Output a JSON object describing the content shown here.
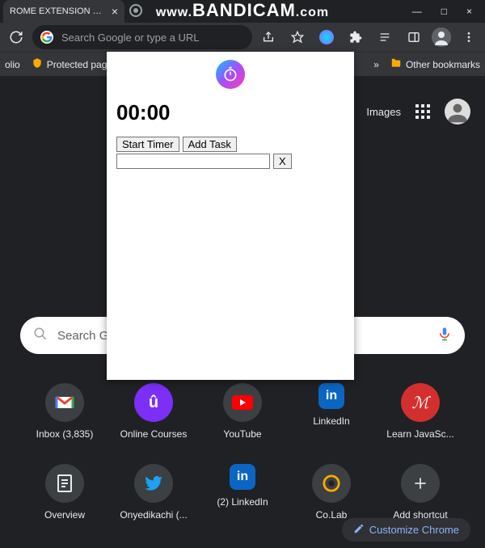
{
  "watermark": "WWW.BANDICAM.COM",
  "tabs": {
    "left_partial": "ROME EXTENSION FOR"
  },
  "window": {
    "minimize": "—",
    "maximize": "□",
    "close": "×"
  },
  "omnibox": {
    "placeholder": "Search Google or type a URL"
  },
  "bookmarks": {
    "item0": "olio",
    "item1": "Protected pag",
    "other": "Other bookmarks",
    "chevron": "»"
  },
  "ntp": {
    "images_link": "Images",
    "search_placeholder": "Search Goo",
    "customize": "Customize Chrome"
  },
  "shortcuts": [
    {
      "label": "Inbox (3,835)",
      "letter": "M",
      "bg": "#3c4043"
    },
    {
      "label": "Online Courses",
      "letter": "Û",
      "bg": "#3c4043"
    },
    {
      "label": "YouTube",
      "letter": "▶",
      "bg": "#3c4043"
    },
    {
      "label": "LinkedIn",
      "letter": "in",
      "bg": "#3c4043"
    },
    {
      "label": "Learn JavaSc...",
      "letter": "ℳ",
      "bg": "#3c4043"
    },
    {
      "label": "Overview",
      "letter": "🗎",
      "bg": "#3c4043"
    },
    {
      "label": "Onyedikachi (...",
      "letter": "🐦",
      "bg": "#3c4043"
    },
    {
      "label": "(2) LinkedIn",
      "letter": "in",
      "bg": "#3c4043"
    },
    {
      "label": "Co.Lab",
      "letter": "◎",
      "bg": "#3c4043"
    },
    {
      "label": "Add shortcut",
      "letter": "+",
      "bg": "#3c4043"
    }
  ],
  "popup": {
    "timer": "00:00",
    "start": "Start Timer",
    "add": "Add Task",
    "remove": "X"
  }
}
